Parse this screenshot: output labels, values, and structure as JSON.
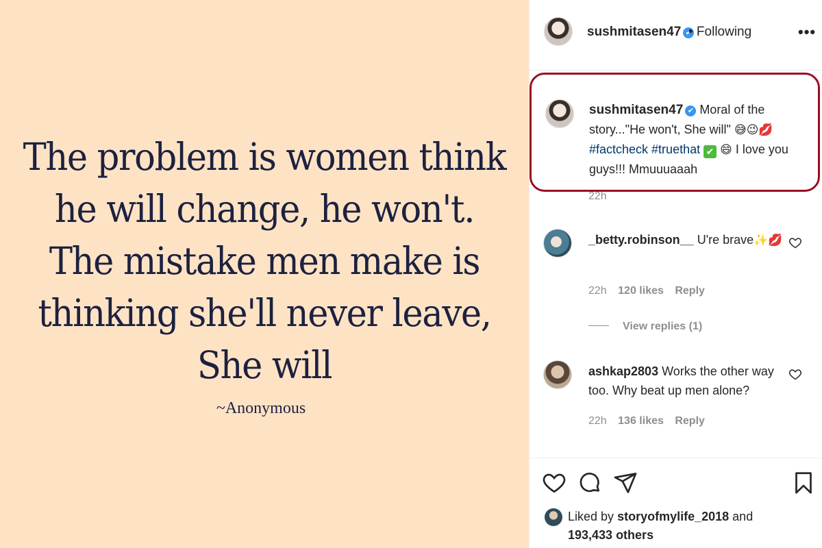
{
  "quote": {
    "lines": [
      "The problem is women think",
      "he will change, he won't.",
      "The mistake men make is",
      "thinking she'll never leave,",
      "She will"
    ],
    "attribution": "~Anonymous"
  },
  "header": {
    "username": "sushmitasen47",
    "verified_icon": "✔",
    "following": "• Following",
    "more_icon": "•••"
  },
  "caption": {
    "username": "sushmitasen47",
    "text_1": "Moral of the story...\"He won't, She will\"",
    "emoji_1": "😅😉💋",
    "hashtags": "#factcheck #truethat",
    "check_emoji": "✔",
    "emoji_2": "😄",
    "text_2": "I love you guys!!! Mmuuuaaah",
    "time": "22h"
  },
  "comments": [
    {
      "username": "_betty.robinson__",
      "text": "U're brave",
      "emoji": "✨💋",
      "time": "22h",
      "likes": "120 likes",
      "reply": "Reply",
      "view_replies": "View replies (1)"
    },
    {
      "username": "ashkap2803",
      "text": "Works the other way too. Why beat up men alone?",
      "time": "22h",
      "likes": "136 likes",
      "reply": "Reply"
    }
  ],
  "footer": {
    "liked_prefix": "Liked by",
    "liked_user": "storyofmylife_2018",
    "liked_suffix": "and",
    "others": "193,433 others"
  },
  "colors": {
    "image_bg": "#fde3c4",
    "quote_text": "#1d2140",
    "highlight_border": "#9b0e22",
    "hashtag": "#00376b",
    "verified": "#3897f0",
    "muted": "#8e8e8e"
  }
}
